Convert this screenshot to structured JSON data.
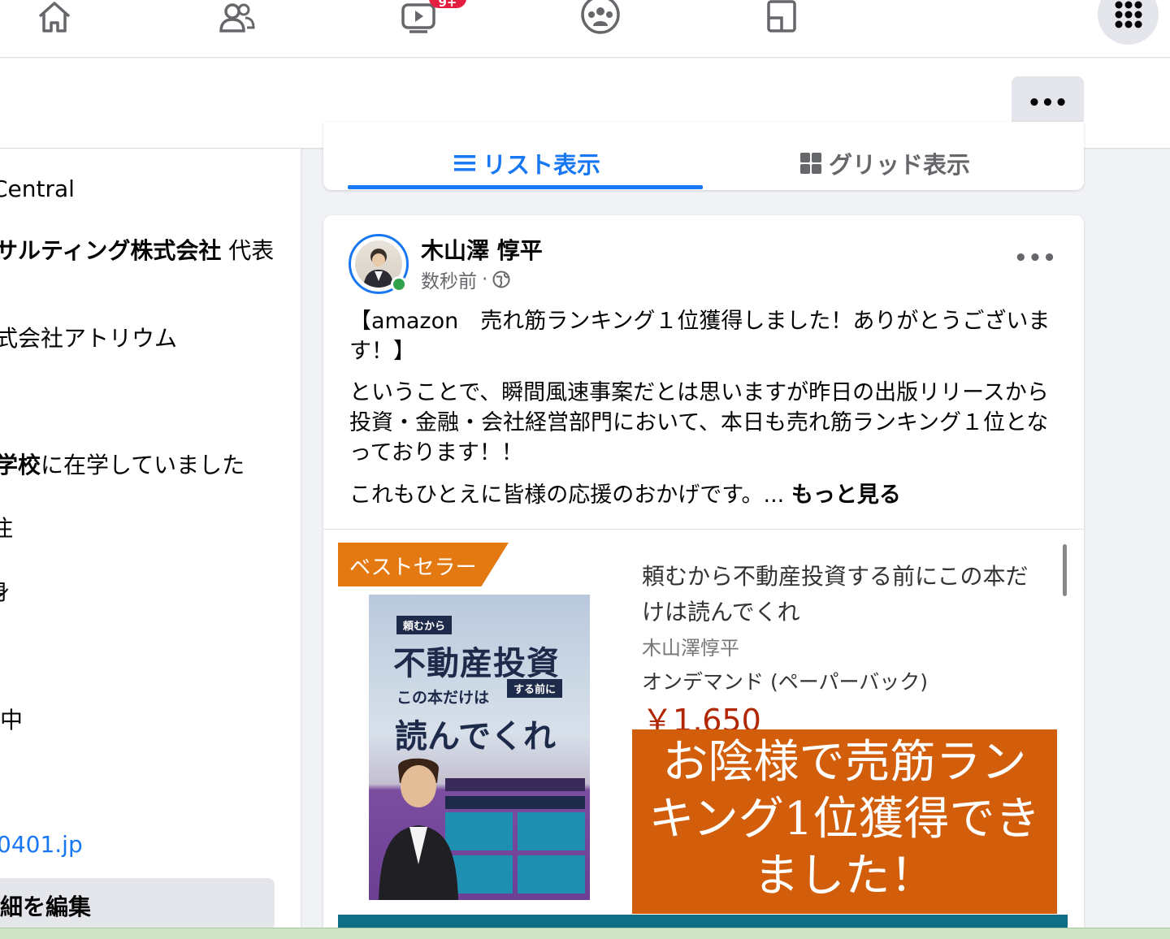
{
  "topnav": {
    "icons": [
      "home-icon",
      "friends-icon",
      "watch-icon",
      "groups-icon",
      "gaming-icon",
      "menu-grid-icon"
    ],
    "watch_badge": "9+"
  },
  "subheader": {
    "more_label": "•••"
  },
  "intro": {
    "lines": [
      {
        "text_bold": "",
        "text": "Central"
      },
      {
        "text_bold": "サルティング株式会社",
        "text": " 代表"
      },
      {
        "text_bold": "",
        "text": "式会社アトリウム"
      },
      {
        "text_bold": "学校",
        "text": "に在学していました"
      },
      {
        "text_bold": "",
        "text": "住"
      },
      {
        "text_bold": "",
        "text": "身"
      },
      {
        "text_bold": "",
        "text": "中"
      }
    ],
    "link": "0401.jp",
    "edit_label": "細を編集"
  },
  "view_switch": {
    "list_label": "リスト表示",
    "grid_label": "グリッド表示"
  },
  "post": {
    "author": "木山澤 惇平",
    "time": "数秒前",
    "separator": "·",
    "more_label": "•••",
    "heading": "【amazon　売れ筋ランキング１位獲得しました！ありがとうございます！】",
    "body": "ということで、瞬間風速事案だとは思いますが昨日の出版リリースから投資・金融・会社経営部門において、本日も売れ筋ランキング１位となっております！！",
    "teaser": "これもひとえに皆様の応援のおかげです。...",
    "see_more": "もっと見る",
    "preview": {
      "tag": "ベストセラー",
      "cover": {
        "small": "頼むから",
        "big": "不動産投資",
        "sub1": "する前に",
        "sub2": "この本だけは",
        "mid": "読んでくれ"
      },
      "title": "頼むから不動産投資する前にこの本だけは読んでくれ",
      "author": "木山澤惇平",
      "format": "オンデマンド (ペーパーバック)",
      "price": "￥1,650",
      "banner": "お陰様で売筋ランキング1位獲得できました！"
    }
  },
  "colors": {
    "accent": "#1877f2",
    "banner": "#d25d0a",
    "tag": "#e47911",
    "teal": "#0f6e86"
  }
}
